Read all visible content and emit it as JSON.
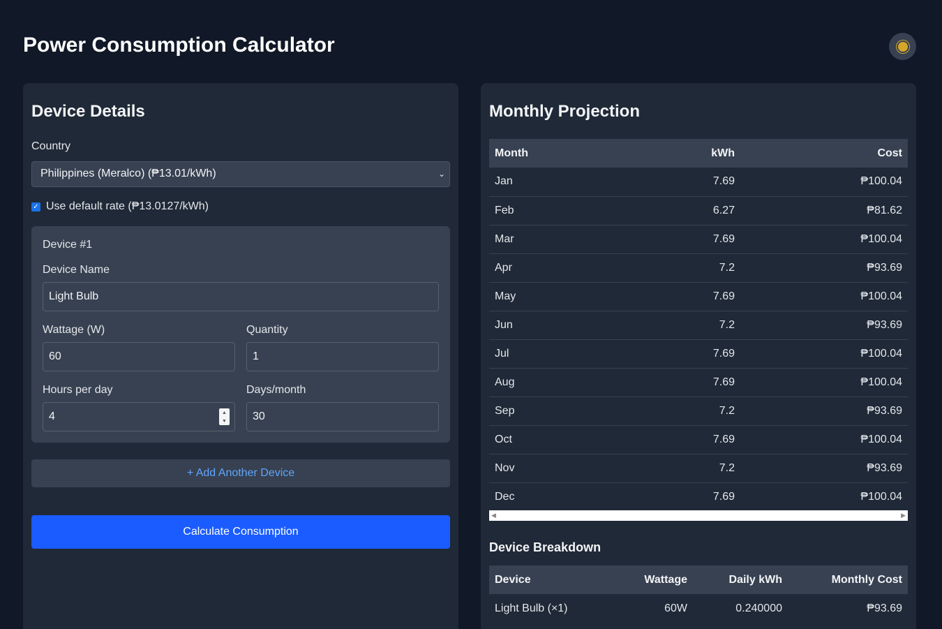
{
  "page": {
    "title": "Power Consumption Calculator"
  },
  "theme_toggle": {
    "icon": "sun-icon"
  },
  "device_details": {
    "title": "Device Details",
    "country_label": "Country",
    "country_value": "Philippines (Meralco) (₱13.01/kWh)",
    "default_rate_checked": true,
    "default_rate_label": "Use default rate (₱13.0127/kWh)",
    "device": {
      "header": "Device #1",
      "name_label": "Device Name",
      "name_value": "Light Bulb",
      "wattage_label": "Wattage (W)",
      "wattage_value": "60",
      "quantity_label": "Quantity",
      "quantity_value": "1",
      "hours_label": "Hours per day",
      "hours_value": "4",
      "days_label": "Days/month",
      "days_value": "30"
    },
    "add_device_label": "+ Add Another Device",
    "calculate_label": "Calculate Consumption"
  },
  "monthly_projection": {
    "title": "Monthly Projection",
    "columns": [
      "Month",
      "kWh",
      "Cost"
    ],
    "rows": [
      [
        "Jan",
        "7.69",
        "₱100.04"
      ],
      [
        "Feb",
        "6.27",
        "₱81.62"
      ],
      [
        "Mar",
        "7.69",
        "₱100.04"
      ],
      [
        "Apr",
        "7.2",
        "₱93.69"
      ],
      [
        "May",
        "7.69",
        "₱100.04"
      ],
      [
        "Jun",
        "7.2",
        "₱93.69"
      ],
      [
        "Jul",
        "7.69",
        "₱100.04"
      ],
      [
        "Aug",
        "7.69",
        "₱100.04"
      ],
      [
        "Sep",
        "7.2",
        "₱93.69"
      ],
      [
        "Oct",
        "7.69",
        "₱100.04"
      ],
      [
        "Nov",
        "7.2",
        "₱93.69"
      ],
      [
        "Dec",
        "7.69",
        "₱100.04"
      ]
    ]
  },
  "device_breakdown": {
    "title": "Device Breakdown",
    "columns": [
      "Device",
      "Wattage",
      "Daily kWh",
      "Monthly Cost"
    ],
    "rows": [
      [
        "Light Bulb (×1)",
        "60W",
        "0.240000",
        "₱93.69"
      ]
    ]
  },
  "colors": {
    "background": "#111827",
    "panel": "#1f2937",
    "accent": "#1a5cff",
    "link": "#60a5fa"
  }
}
